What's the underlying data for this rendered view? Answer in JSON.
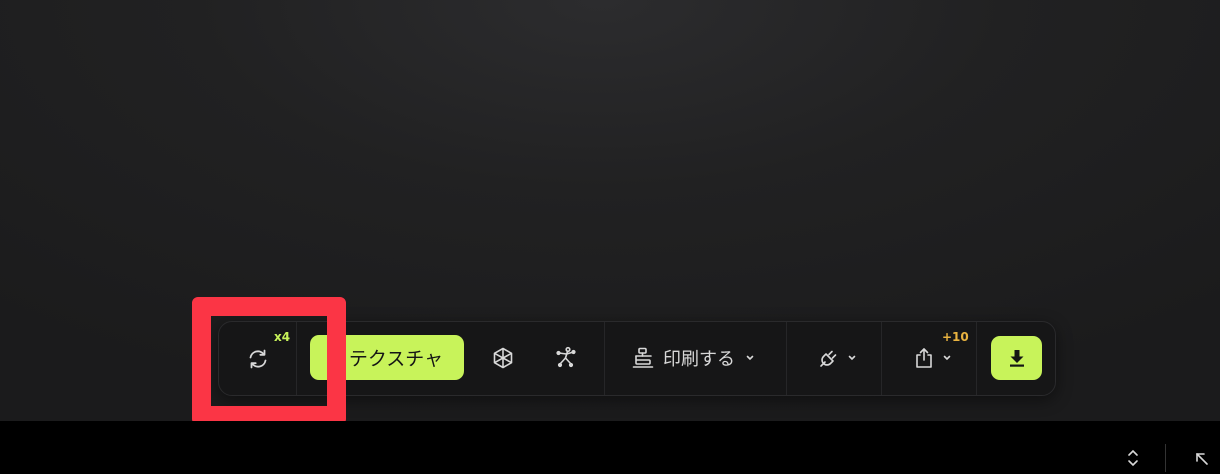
{
  "toolbar": {
    "regenerate": {
      "icon": "refresh-icon",
      "badge": "x4",
      "badge_color": "#c8f35a"
    },
    "texture": {
      "label": "テクスチャ",
      "icon": "texture-icon"
    },
    "mesh": {
      "icon": "mesh-icon"
    },
    "rig": {
      "icon": "rig-icon"
    },
    "print": {
      "label": "印刷する",
      "icon": "printer-icon"
    },
    "plugin": {
      "icon": "plug-icon"
    },
    "share": {
      "icon": "share-icon",
      "badge": "+10",
      "badge_color": "#e9b340"
    },
    "download": {
      "icon": "download-icon"
    }
  },
  "colors": {
    "accent": "#c8f35a",
    "highlight": "#fb3545",
    "background": "#1c1c1d"
  }
}
